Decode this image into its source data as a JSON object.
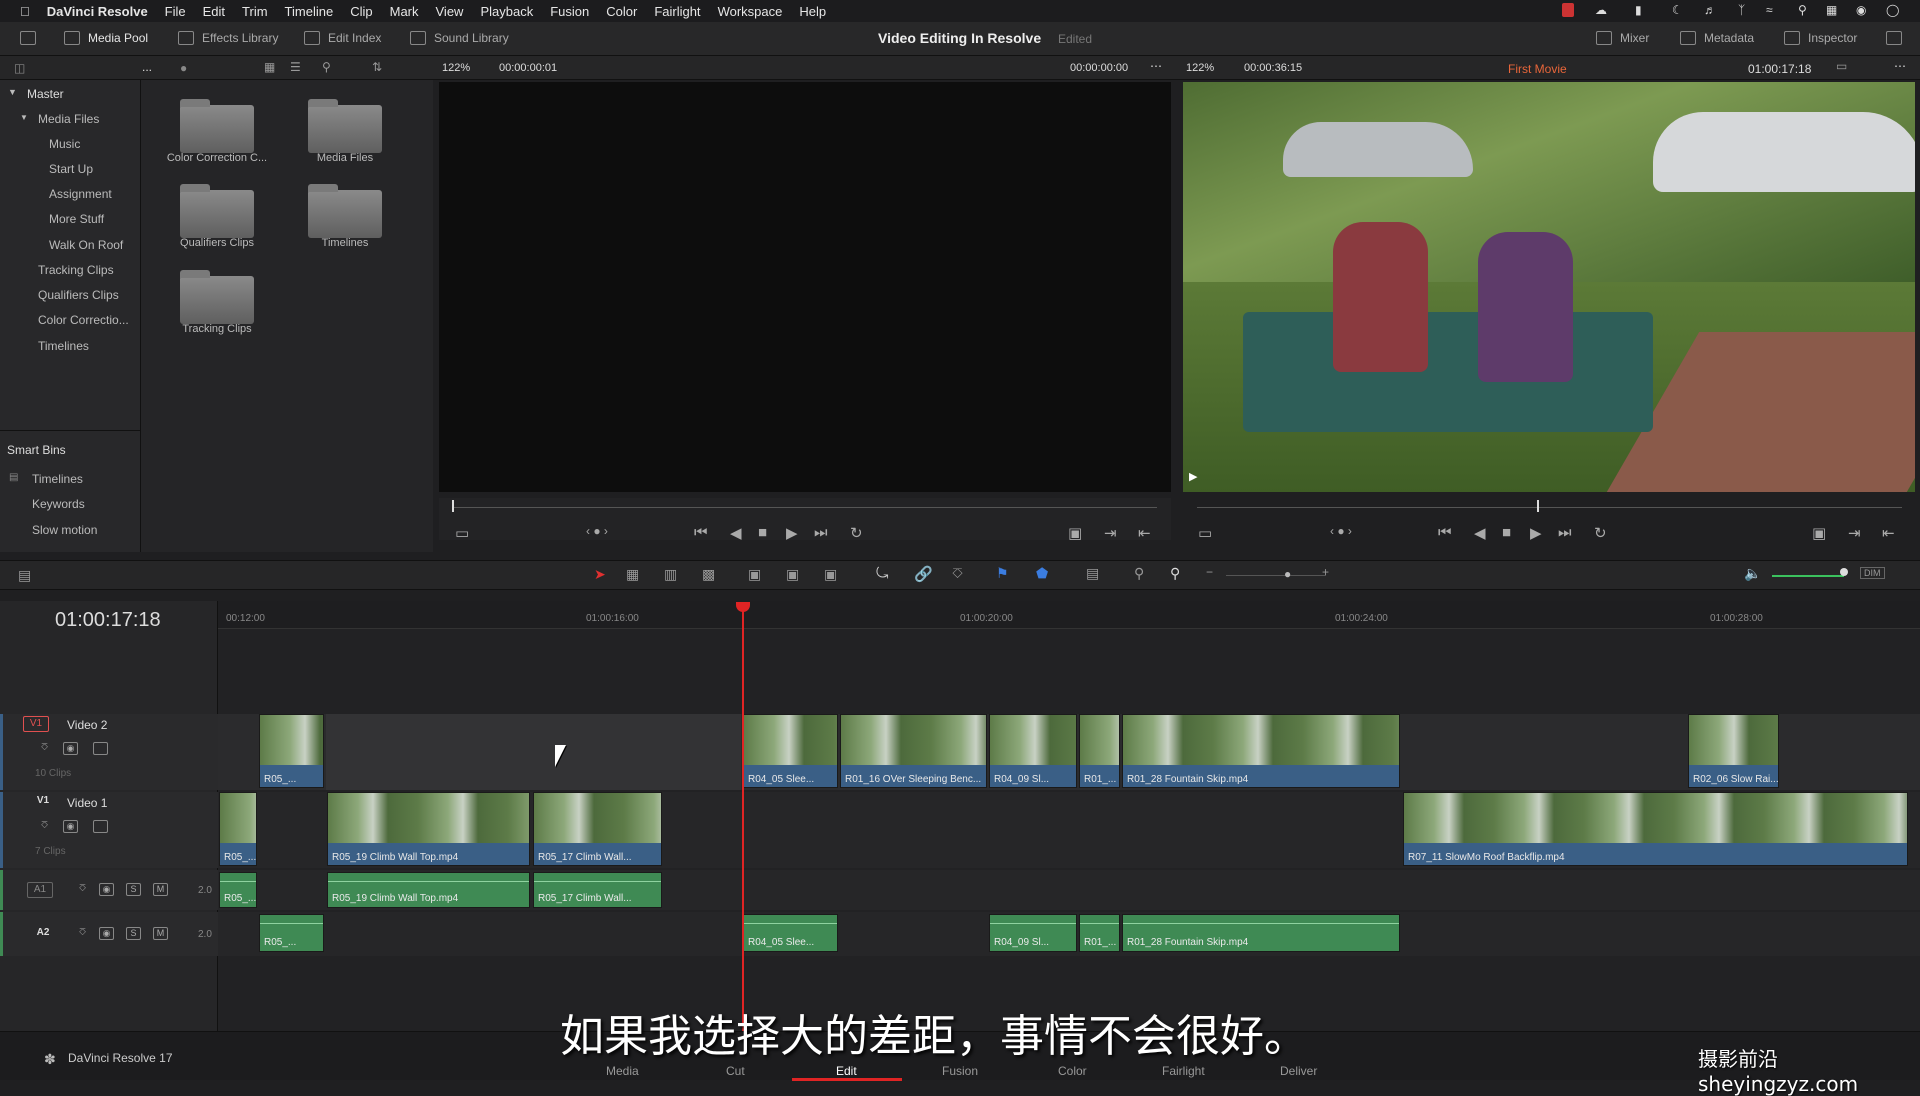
{
  "menubar": {
    "app": "DaVinci Resolve",
    "items": [
      "File",
      "Edit",
      "Trim",
      "Timeline",
      "Clip",
      "Mark",
      "View",
      "Playback",
      "Fusion",
      "Color",
      "Fairlight",
      "Workspace",
      "Help"
    ]
  },
  "toolbar": {
    "media_pool": "Media Pool",
    "effects_library": "Effects Library",
    "edit_index": "Edit Index",
    "sound_library": "Sound Library",
    "project_title": "Video Editing In Resolve",
    "project_status": "Edited",
    "mixer": "Mixer",
    "metadata": "Metadata",
    "inspector": "Inspector"
  },
  "subbar": {
    "src_zoom": "122%",
    "src_timecode": "00:00:00:01",
    "src_duration": "00:00:00:00",
    "prog_zoom": "122%",
    "prog_duration": "00:00:36:15",
    "timeline_name": "First Movie",
    "prog_timecode": "01:00:17:18",
    "ellipsis": "..."
  },
  "bins": {
    "master": "Master",
    "media_files": "Media Files",
    "children": [
      "Music",
      "Start Up",
      "Assignment",
      "More Stuff",
      "Walk On Roof"
    ],
    "others": [
      "Tracking Clips",
      "Qualifiers Clips",
      "Color Correctio...",
      "Timelines"
    ],
    "smart_bins": "Smart Bins",
    "smart_items": [
      "Timelines",
      "Keywords",
      "Slow motion"
    ]
  },
  "pool": {
    "folders": [
      "Color Correction C...",
      "Media Files",
      "Qualifiers Clips",
      "Timelines",
      "Tracking Clips"
    ]
  },
  "timeline": {
    "timecode": "01:00:17:18",
    "ticks": [
      "00:12:00",
      "01:00:16:00",
      "01:00:20:00",
      "01:00:24:00",
      "01:00:28:00"
    ],
    "v2": {
      "badge": "V1",
      "name": "Video 2",
      "clips_count": "10 Clips"
    },
    "v1": {
      "badge": "V1",
      "name": "Video 1",
      "clips_count": "7 Clips"
    },
    "a1": {
      "badge": "A1",
      "level": "2.0"
    },
    "a2": {
      "badge": "A2",
      "level": "2.0"
    },
    "s": "S",
    "m": "M",
    "v2_clips": [
      "R05_...",
      "R04_05 Slee...",
      "R01_16 OVer Sleeping Benc...",
      "R04_09 Sl...",
      "R01_...",
      "R01_28 Fountain Skip.mp4",
      "R02_06 Slow Rai..."
    ],
    "v1_clips": [
      "R05_...",
      "R05_19 Climb Wall Top.mp4",
      "R05_17 Climb Wall...",
      "R07_11 SlowMo Roof Backflip.mp4"
    ],
    "a1_clips": [
      "R05_...",
      "R05_19 Climb Wall Top.mp4",
      "R05_17 Climb Wall..."
    ],
    "a2_clips": [
      "R05_...",
      "R04_05 Slee...",
      "R04_09 Sl...",
      "R01_...",
      "R01_28 Fountain Skip.mp4"
    ]
  },
  "pages": [
    "Media",
    "Cut",
    "Edit",
    "Fusion",
    "Color",
    "Fairlight",
    "Deliver"
  ],
  "footer": {
    "version": "DaVinci Resolve 17"
  },
  "subtitle": "如果我选择大的差距，事情不会很好。",
  "watermark": "摄影前沿 sheyingzyz.com",
  "colors": {
    "accent": "#e02424",
    "video_clip": "#3a5f86",
    "audio_clip": "#3f8a54",
    "timeline_name": "#e8663a"
  }
}
